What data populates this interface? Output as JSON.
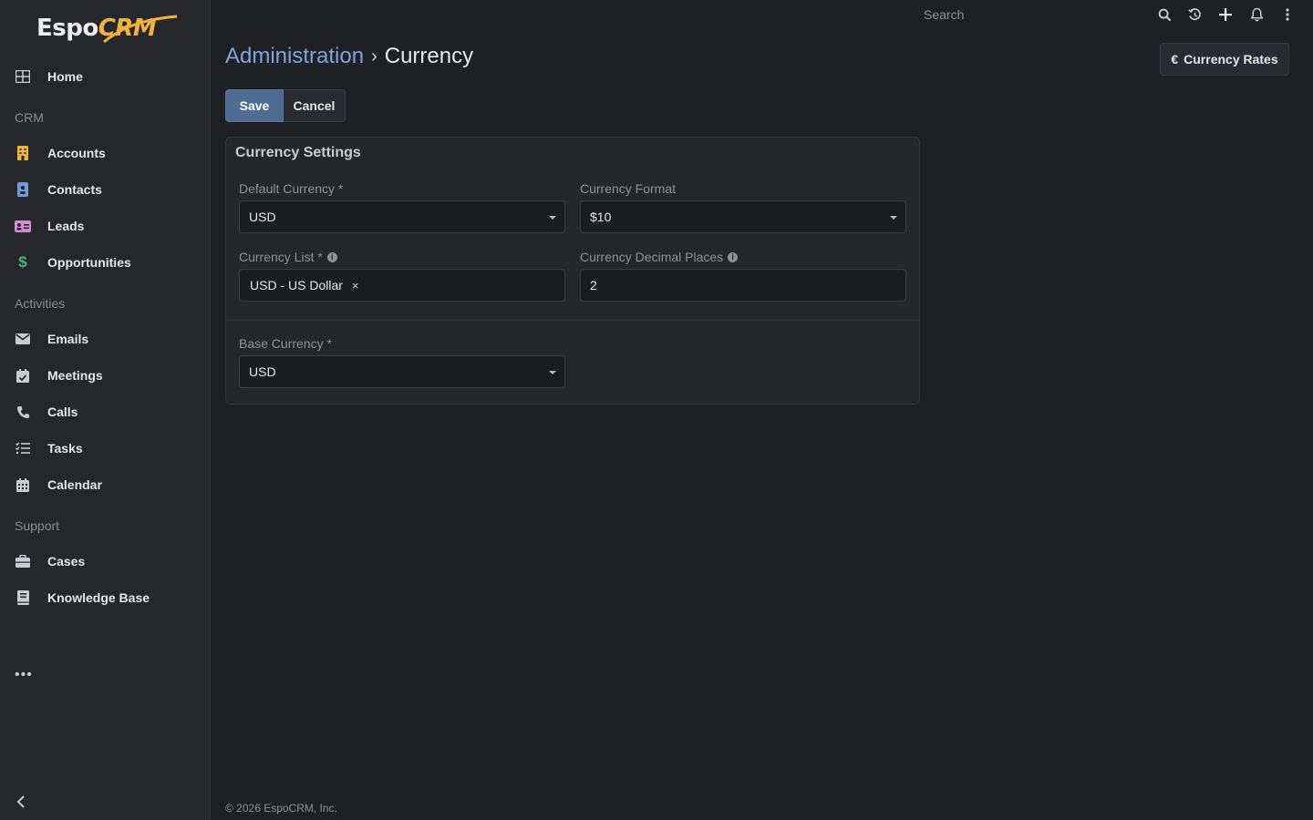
{
  "app": {
    "logo_text": "EspoCRM",
    "logo_part1": "Espo",
    "logo_part2": "CRM"
  },
  "sidebar": {
    "items": [
      {
        "label": "Home",
        "icon": "home-grid-icon"
      },
      {
        "label": "Accounts",
        "icon": "building-icon"
      },
      {
        "label": "Contacts",
        "icon": "contact-card-icon"
      },
      {
        "label": "Leads",
        "icon": "id-card-icon"
      },
      {
        "label": "Opportunities",
        "icon": "dollar-icon"
      },
      {
        "label": "Emails",
        "icon": "envelope-icon"
      },
      {
        "label": "Meetings",
        "icon": "calendar-check-icon"
      },
      {
        "label": "Calls",
        "icon": "phone-icon"
      },
      {
        "label": "Tasks",
        "icon": "task-list-icon"
      },
      {
        "label": "Calendar",
        "icon": "calendar-icon"
      },
      {
        "label": "Cases",
        "icon": "briefcase-icon"
      },
      {
        "label": "Knowledge Base",
        "icon": "book-icon"
      }
    ],
    "groups": {
      "crm": "CRM",
      "activities": "Activities",
      "support": "Support"
    },
    "more": "•••"
  },
  "topbar": {
    "search_placeholder": "Search"
  },
  "header": {
    "breadcrumb_parent": "Administration",
    "breadcrumb_separator": "›",
    "breadcrumb_current": "Currency",
    "rates_button": "Currency Rates",
    "rates_icon": "€"
  },
  "actions": {
    "save": "Save",
    "cancel": "Cancel"
  },
  "panel": {
    "title": "Currency Settings",
    "fields": {
      "default_currency": {
        "label": "Default Currency *",
        "value": "USD"
      },
      "currency_format": {
        "label": "Currency Format",
        "value": "$10"
      },
      "currency_list": {
        "label": "Currency List *",
        "chip": "USD - US Dollar",
        "remove": "×"
      },
      "decimal_places": {
        "label": "Currency Decimal Places",
        "value": "2"
      },
      "base_currency": {
        "label": "Base Currency *",
        "value": "USD"
      }
    }
  },
  "footer": {
    "copyright": "© 2026 EspoCRM, Inc."
  },
  "colors": {
    "accent_link": "#7fa6d6",
    "save_button": "#4f6c93",
    "logo_orange": "#f2b33d",
    "accounts_icon": "#f2b33d",
    "contacts_icon": "#6f9bd8",
    "leads_icon": "#d58ad6",
    "opportunities_icon": "#49b57a"
  }
}
